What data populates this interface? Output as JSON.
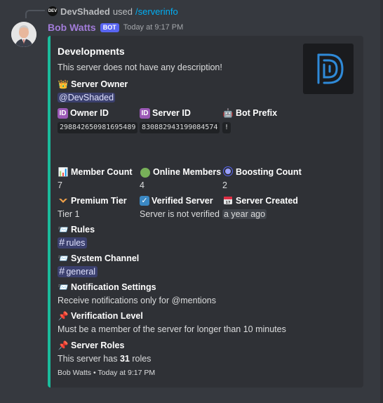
{
  "reply": {
    "username": "DevShaded",
    "used_text": "used",
    "command": "/serverinfo",
    "avatar_text": "DEV"
  },
  "message": {
    "username": "Bob Watts",
    "bot_tag": "BOT",
    "timestamp": "Today at 9:17 PM"
  },
  "embed": {
    "accent_color": "#1abc9c",
    "title": "Developments",
    "description": "This server does not have any description!",
    "thumbnail_icon": "developments-logo",
    "fields": {
      "server_owner": {
        "icon": "crown-icon",
        "name": "Server Owner",
        "value": "@DevShaded"
      },
      "owner_id": {
        "icon": "id-icon",
        "name": "Owner ID",
        "value": "298842650981695489"
      },
      "server_id": {
        "icon": "id-icon",
        "name": "Server ID",
        "value": "830882943199084574"
      },
      "bot_prefix": {
        "icon": "robot-icon",
        "name": "Bot Prefix",
        "value": "!"
      },
      "member_count": {
        "icon": "bar-chart-icon",
        "name": "Member Count",
        "value": "7"
      },
      "online_members": {
        "icon": "green-circle-icon",
        "name": "Online Members",
        "value": "4"
      },
      "boosting_count": {
        "icon": "boost-icon",
        "name": "Boosting Count",
        "value": "2"
      },
      "premium_tier": {
        "icon": "nitro-icon",
        "name": "Premium Tier",
        "value": "Tier 1"
      },
      "verified_server": {
        "icon": "check-icon",
        "name": "Verified Server",
        "value": "Server is not verified"
      },
      "server_created": {
        "icon": "calendar-icon",
        "name": "Server Created",
        "value": "a year ago"
      },
      "rules": {
        "icon": "envelope-icon",
        "name": "Rules",
        "value": "rules"
      },
      "system_channel": {
        "icon": "envelope-icon",
        "name": "System Channel",
        "value": "general"
      },
      "notification_settings": {
        "icon": "envelope-icon",
        "name": "Notification Settings",
        "value": "Receive notifications only for @mentions"
      },
      "verification_level": {
        "icon": "pin-icon",
        "name": "Verification Level",
        "value": "Must be a member of the server for longer than 10 minutes"
      },
      "server_roles": {
        "icon": "pin-icon",
        "name": "Server Roles",
        "value_prefix": "This server has",
        "value_count": "31",
        "value_suffix": "roles"
      }
    },
    "footer": {
      "author": "Bob Watts",
      "separator": "•",
      "timestamp": "Today at 9:17 PM"
    }
  }
}
